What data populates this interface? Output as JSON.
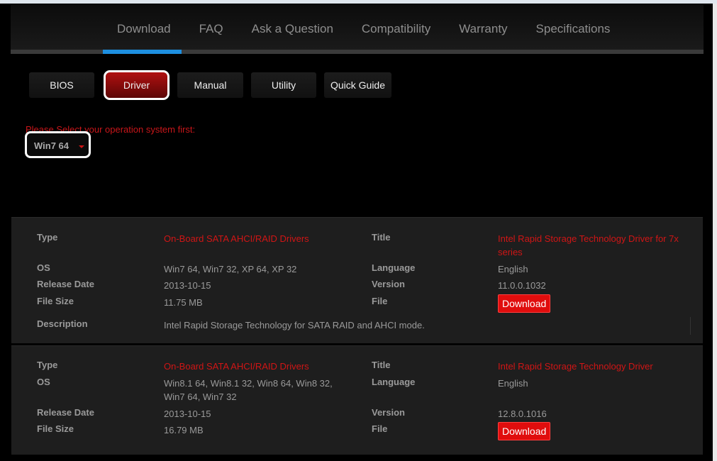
{
  "nav": {
    "items": [
      "Download",
      "FAQ",
      "Ask a Question",
      "Compatibility",
      "Warranty",
      "Specifications"
    ],
    "active": "Download"
  },
  "subtabs": {
    "items": [
      "BIOS",
      "Driver",
      "Manual",
      "Utility",
      "Quick Guide"
    ],
    "active": "Driver"
  },
  "os_select": {
    "prompt": "Please Select your operation system first:",
    "value": "Win7 64"
  },
  "labels": {
    "type": "Type",
    "os": "OS",
    "release_date": "Release Date",
    "file_size": "File Size",
    "description": "Description",
    "title": "Title",
    "language": "Language",
    "version": "Version",
    "file": "File",
    "download": "Download"
  },
  "drivers": [
    {
      "type": "On-Board SATA AHCI/RAID Drivers",
      "title": "Intel Rapid Storage Technology Driver for 7x series",
      "os": "Win7 64, Win7 32, XP 64, XP 32",
      "language": "English",
      "release_date": "2013-10-15",
      "version": "11.0.0.1032",
      "file_size": "11.75 MB",
      "description": "Intel Rapid Storage Technology for SATA RAID and AHCI mode."
    },
    {
      "type": "On-Board SATA AHCI/RAID Drivers",
      "title": "Intel Rapid Storage Technology Driver",
      "os": "Win8.1 64, Win8.1 32, Win8 64, Win8 32, Win7 64, Win7 32",
      "language": "English",
      "release_date": "2013-10-15",
      "version": "12.8.0.1016",
      "file_size": "16.79 MB"
    }
  ],
  "colors": {
    "accent": "#1d8fe0",
    "red": "#d01515"
  }
}
